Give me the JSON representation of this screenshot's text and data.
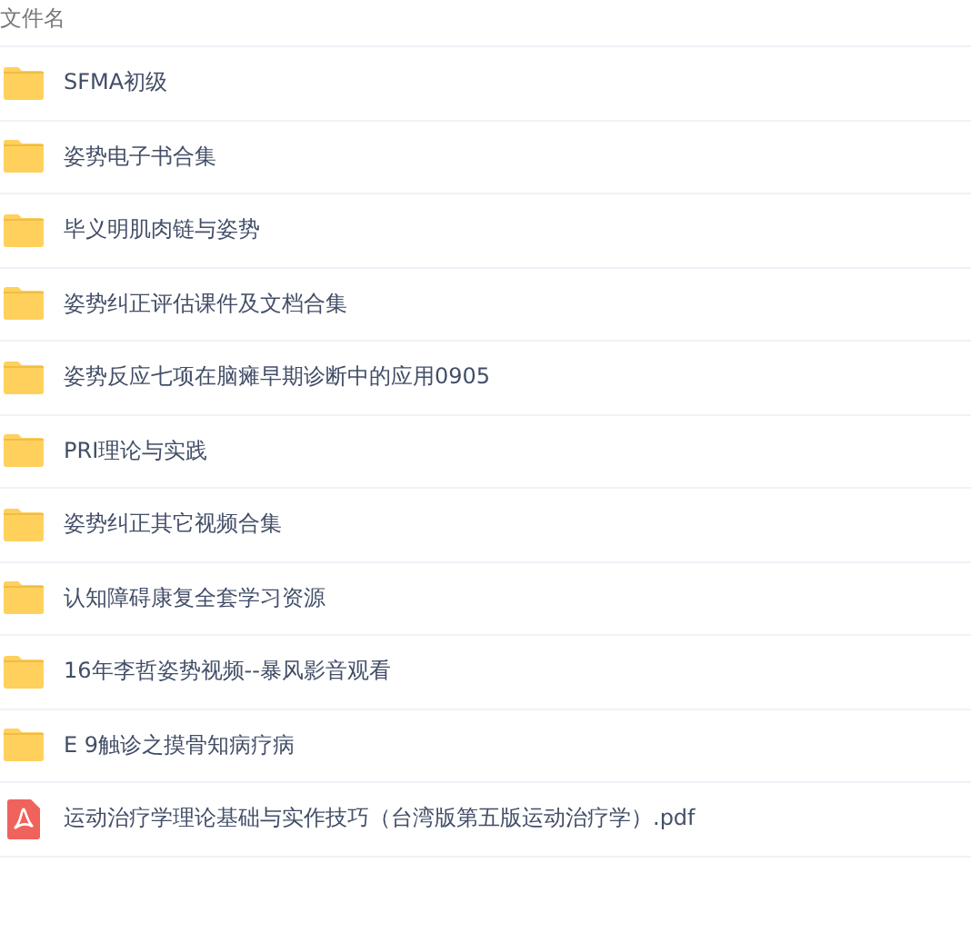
{
  "table": {
    "columns": [
      "文件名"
    ],
    "rows": [
      {
        "kind": "folder",
        "name": "SFMA初级"
      },
      {
        "kind": "folder",
        "name": "姿势电子书合集"
      },
      {
        "kind": "folder",
        "name": "毕义明肌肉链与姿势"
      },
      {
        "kind": "folder",
        "name": "姿势纠正评估课件及文档合集"
      },
      {
        "kind": "folder",
        "name": "姿势反应七项在脑瘫早期诊断中的应用0905"
      },
      {
        "kind": "folder",
        "name": "PRI理论与实践"
      },
      {
        "kind": "folder",
        "name": "姿势纠正其它视频合集"
      },
      {
        "kind": "folder",
        "name": "认知障碍康复全套学习资源"
      },
      {
        "kind": "folder",
        "name": "16年李哲姿势视频--暴风影音观看"
      },
      {
        "kind": "folder",
        "name": "E 9触诊之摸骨知病疗病"
      },
      {
        "kind": "pdf",
        "name": "运动治疗学理论基础与实作技巧（台湾版第五版运动治疗学）.pdf"
      }
    ]
  }
}
